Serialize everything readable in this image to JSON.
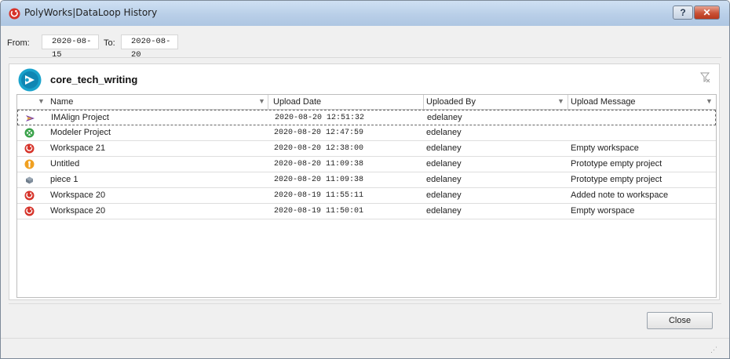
{
  "window": {
    "title": "PolyWorks|DataLoop History",
    "help_label": "?",
    "close_label": "✕"
  },
  "filters": {
    "from_label": "From:",
    "from_value": "2020-08-15",
    "to_label": "To:",
    "to_value": "2020-08-20"
  },
  "workspace": {
    "name": "core_tech_writing"
  },
  "table": {
    "columns": [
      {
        "label": "Name"
      },
      {
        "label": "Upload Date"
      },
      {
        "label": "Uploaded By"
      },
      {
        "label": "Upload Message"
      }
    ],
    "rows": [
      {
        "icon": "imalign-icon",
        "name": "IMAlign Project",
        "date": "2020-08-20 12:51:32",
        "by": "edelaney",
        "message": ""
      },
      {
        "icon": "modeler-icon",
        "name": "Modeler Project",
        "date": "2020-08-20 12:47:59",
        "by": "edelaney",
        "message": ""
      },
      {
        "icon": "workspace-icon",
        "name": "Workspace 21",
        "date": "2020-08-20 12:38:00",
        "by": "edelaney",
        "message": "Empty workspace"
      },
      {
        "icon": "inspector-icon",
        "name": "Untitled",
        "date": "2020-08-20 11:09:38",
        "by": "edelaney",
        "message": "Prototype empty project"
      },
      {
        "icon": "piece-icon",
        "name": "piece 1",
        "date": "2020-08-20 11:09:38",
        "by": "edelaney",
        "message": "Prototype empty project"
      },
      {
        "icon": "workspace-icon",
        "name": "Workspace 20",
        "date": "2020-08-19 11:55:11",
        "by": "edelaney",
        "message": "Added note to workspace"
      },
      {
        "icon": "workspace-icon",
        "name": "Workspace 20",
        "date": "2020-08-19 11:50:01",
        "by": "edelaney",
        "message": "Empty worspace"
      }
    ]
  },
  "footer": {
    "close_button": "Close"
  },
  "colors": {
    "titlebar": "#b9cfe8",
    "close_red": "#c95236",
    "workspace_red": "#d6332a",
    "logo_teal": "#1aa3cc"
  }
}
